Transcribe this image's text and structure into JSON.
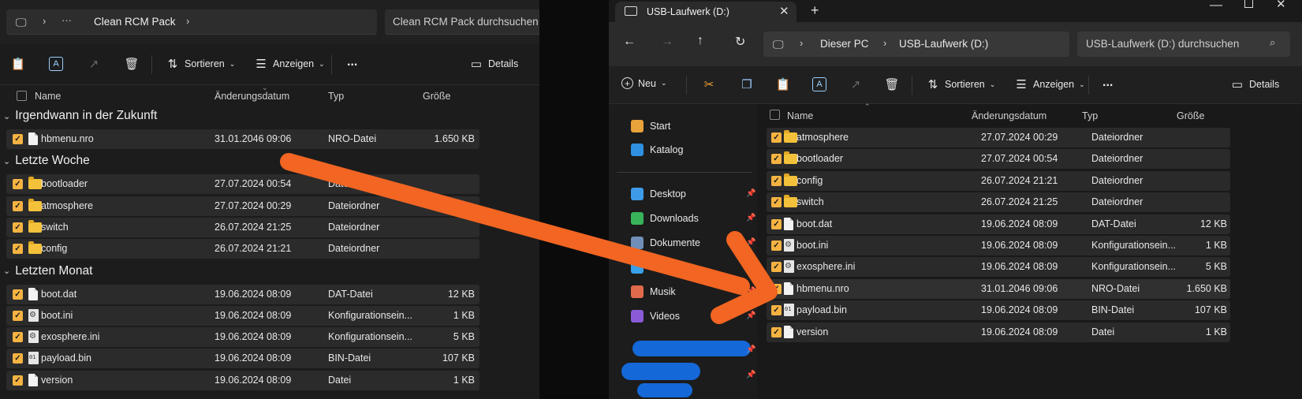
{
  "left": {
    "breadcrumb": [
      "Clean RCM Pack"
    ],
    "search_placeholder": "Clean RCM Pack durchsuchen",
    "toolbar": {
      "sort": "Sortieren",
      "view": "Anzeigen",
      "more": "...",
      "details": "Details"
    },
    "columns": {
      "name": "Name",
      "date": "Änderungsdatum",
      "type": "Typ",
      "size": "Größe"
    },
    "groups": [
      {
        "title": "Irgendwann in der Zukunft",
        "rows": [
          {
            "name": "hbmenu.nro",
            "date": "31.01.2046 09:06",
            "type": "NRO-Datei",
            "size": "1.650 KB",
            "icon": "doc"
          }
        ]
      },
      {
        "title": "Letzte Woche",
        "rows": [
          {
            "name": "bootloader",
            "date": "27.07.2024 00:54",
            "type": "Dateiordner",
            "size": "",
            "icon": "folder"
          },
          {
            "name": "atmosphere",
            "date": "27.07.2024 00:29",
            "type": "Dateiordner",
            "size": "",
            "icon": "folder"
          },
          {
            "name": "switch",
            "date": "26.07.2024 21:25",
            "type": "Dateiordner",
            "size": "",
            "icon": "folder"
          },
          {
            "name": "config",
            "date": "26.07.2024 21:21",
            "type": "Dateiordner",
            "size": "",
            "icon": "folder"
          }
        ]
      },
      {
        "title": "Letzten Monat",
        "rows": [
          {
            "name": "boot.dat",
            "date": "19.06.2024 08:09",
            "type": "DAT-Datei",
            "size": "12 KB",
            "icon": "doc"
          },
          {
            "name": "boot.ini",
            "date": "19.06.2024 08:09",
            "type": "Konfigurationsein...",
            "size": "1 KB",
            "icon": "gear"
          },
          {
            "name": "exosphere.ini",
            "date": "19.06.2024 08:09",
            "type": "Konfigurationsein...",
            "size": "5 KB",
            "icon": "gear"
          },
          {
            "name": "payload.bin",
            "date": "19.06.2024 08:09",
            "type": "BIN-Datei",
            "size": "107 KB",
            "icon": "bin"
          },
          {
            "name": "version",
            "date": "19.06.2024 08:09",
            "type": "Datei",
            "size": "1 KB",
            "icon": "doc"
          }
        ]
      }
    ]
  },
  "right": {
    "tab_title": "USB-Laufwerk (D:)",
    "breadcrumb": [
      "Dieser PC",
      "USB-Laufwerk (D:)"
    ],
    "search_placeholder": "USB-Laufwerk (D:) durchsuchen",
    "toolbar": {
      "new": "Neu",
      "sort": "Sortieren",
      "view": "Anzeigen",
      "more": "...",
      "details": "Details"
    },
    "columns": {
      "name": "Name",
      "date": "Änderungsdatum",
      "type": "Typ",
      "size": "Größe"
    },
    "nav": [
      {
        "label": "Start",
        "color": "#e8a33a",
        "pinned": false
      },
      {
        "label": "Katalog",
        "color": "#2f8fe0",
        "pinned": false
      },
      {
        "label": "Desktop",
        "color": "#3d9be9",
        "pinned": true
      },
      {
        "label": "Downloads",
        "color": "#39b35a",
        "pinned": true
      },
      {
        "label": "Dokumente",
        "color": "#6f8fb8",
        "pinned": true
      },
      {
        "label": "Bilder",
        "color": "#3aa0e8",
        "pinned": true
      },
      {
        "label": "Musik",
        "color": "#e06a4c",
        "pinned": true
      },
      {
        "label": "Videos",
        "color": "#8a5bd6",
        "pinned": true
      }
    ],
    "rows": [
      {
        "name": "atmosphere",
        "date": "27.07.2024 00:29",
        "type": "Dateiordner",
        "size": "",
        "icon": "folder"
      },
      {
        "name": "bootloader",
        "date": "27.07.2024 00:54",
        "type": "Dateiordner",
        "size": "",
        "icon": "folder"
      },
      {
        "name": "config",
        "date": "26.07.2024 21:21",
        "type": "Dateiordner",
        "size": "",
        "icon": "folder"
      },
      {
        "name": "switch",
        "date": "26.07.2024 21:25",
        "type": "Dateiordner",
        "size": "",
        "icon": "folder"
      },
      {
        "name": "boot.dat",
        "date": "19.06.2024 08:09",
        "type": "DAT-Datei",
        "size": "12 KB",
        "icon": "doc"
      },
      {
        "name": "boot.ini",
        "date": "19.06.2024 08:09",
        "type": "Konfigurationsein...",
        "size": "1 KB",
        "icon": "gear"
      },
      {
        "name": "exosphere.ini",
        "date": "19.06.2024 08:09",
        "type": "Konfigurationsein...",
        "size": "5 KB",
        "icon": "gear"
      },
      {
        "name": "hbmenu.nro",
        "date": "31.01.2046 09:06",
        "type": "NRO-Datei",
        "size": "1.650 KB",
        "icon": "doc"
      },
      {
        "name": "payload.bin",
        "date": "19.06.2024 08:09",
        "type": "BIN-Datei",
        "size": "107 KB",
        "icon": "bin"
      },
      {
        "name": "version",
        "date": "19.06.2024 08:09",
        "type": "Datei",
        "size": "1 KB",
        "icon": "doc"
      }
    ]
  },
  "arrow_color": "#f26522"
}
